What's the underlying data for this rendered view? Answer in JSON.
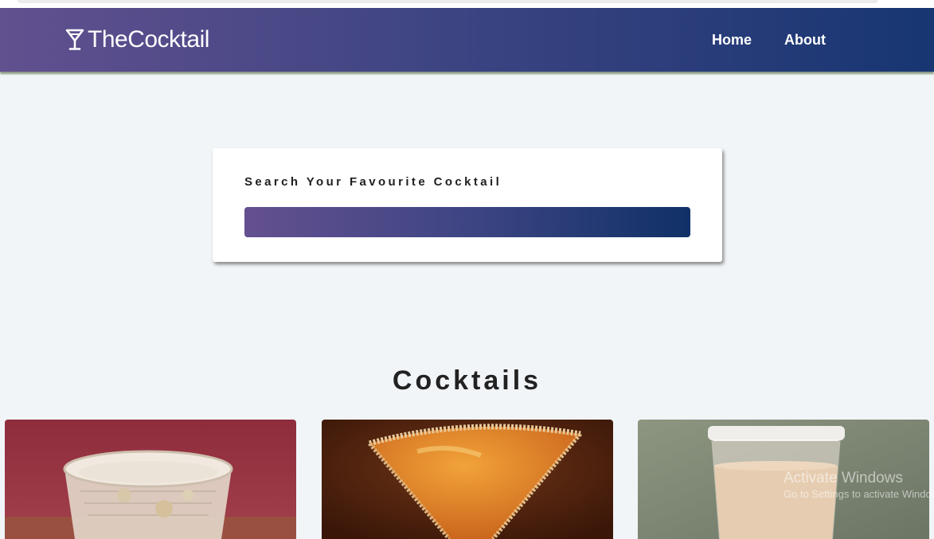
{
  "navbar": {
    "brand": "TheCocktail",
    "links": [
      "Home",
      "About"
    ]
  },
  "search": {
    "label": "Search Your Favourite Cocktail",
    "value": ""
  },
  "cocktails": {
    "heading": "Cocktails"
  },
  "watermark": {
    "title": "Activate Windows",
    "subtitle": "Go to Settings to activate Windows."
  },
  "icons": [
    "cocktail-glass-icon"
  ],
  "colors": {
    "nav_gradient_start": "#62508f",
    "nav_gradient_end": "#173672",
    "page_background": "#f1f5f8"
  }
}
